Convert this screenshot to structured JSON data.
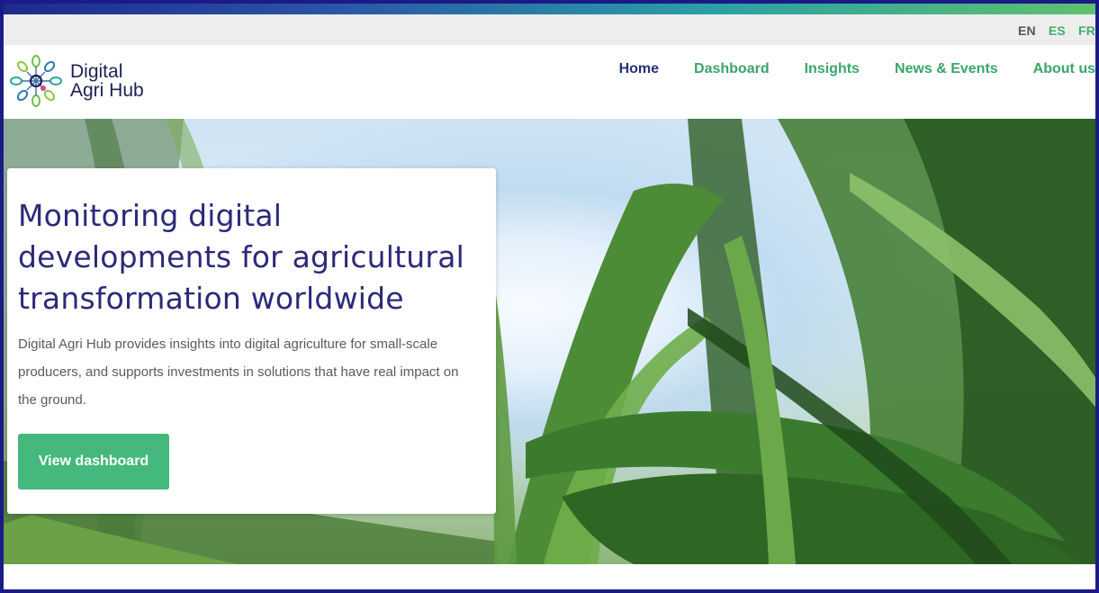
{
  "brand": {
    "name_line1": "Digital",
    "name_line2": "Agri Hub",
    "logo_icon": "network-leaf-logo-icon"
  },
  "languages": [
    {
      "code": "EN",
      "active": true
    },
    {
      "code": "ES",
      "active": false
    },
    {
      "code": "FR",
      "active": false
    }
  ],
  "nav": {
    "items": [
      {
        "label": "Home",
        "active": true
      },
      {
        "label": "Dashboard",
        "active": false
      },
      {
        "label": "Insights",
        "active": false
      },
      {
        "label": "News & Events",
        "active": false
      },
      {
        "label": "About us",
        "active": false
      }
    ]
  },
  "hero": {
    "title_line1": "Monitoring digital",
    "title_line2": "developments for agricultural",
    "title_line3": "transformation worldwide",
    "description": "Digital Agri Hub provides insights into digital agriculture for small-scale producers, and supports investments in solutions that have real impact on the ground.",
    "cta_label": "View dashboard"
  },
  "colors": {
    "primary_navy": "#2b2a7a",
    "accent_green": "#45b87d",
    "nav_green": "#3aa56a",
    "frame_border": "#1b1b87"
  }
}
